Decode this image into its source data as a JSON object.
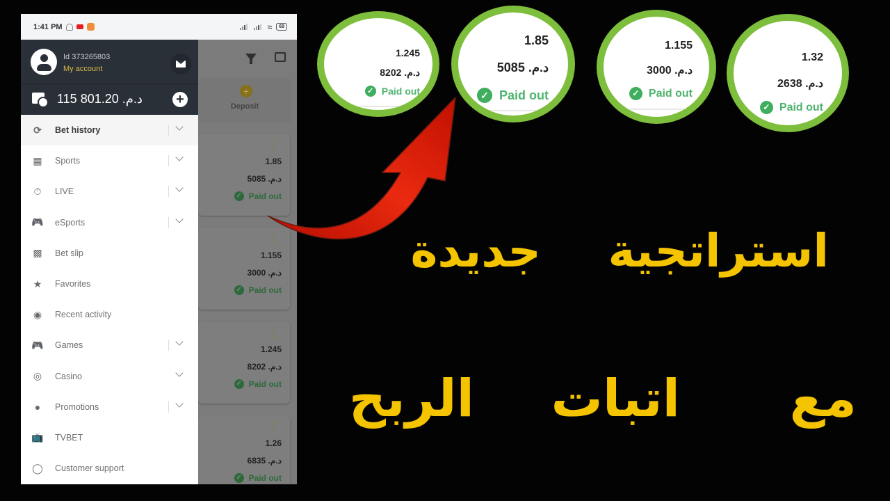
{
  "status_bar": {
    "time": "1:41 PM",
    "battery": "69"
  },
  "background_screen": {
    "deposit_label": "Deposit",
    "bets": [
      {
        "coefficient": "1.85",
        "amount": "5085 .د.م",
        "status": "Paid out"
      },
      {
        "coefficient": "1.155",
        "amount": "3000 .د.م",
        "status": "Paid out"
      },
      {
        "coefficient": "1.245",
        "amount": "8202 .د.م",
        "status": "Paid out"
      },
      {
        "coefficient": "1.26",
        "amount": "6835 .د.م",
        "status": "Paid out"
      }
    ]
  },
  "drawer": {
    "account_id": "Id 373265803",
    "account_link": "My account",
    "balance": "115 801.20 .د.م",
    "menu": [
      {
        "label": "Bet history",
        "icon": "history-icon",
        "expandable": true,
        "active": true
      },
      {
        "label": "Sports",
        "icon": "calendar-icon",
        "expandable": true
      },
      {
        "label": "LIVE",
        "icon": "stopwatch-icon",
        "expandable": true
      },
      {
        "label": "eSports",
        "icon": "gamepad-icon",
        "expandable": true
      },
      {
        "label": "Bet slip",
        "icon": "ticket-icon",
        "expandable": false
      },
      {
        "label": "Favorites",
        "icon": "star-icon",
        "expandable": false
      },
      {
        "label": "Recent activity",
        "icon": "eye-icon",
        "expandable": false
      },
      {
        "label": "Games",
        "icon": "gamepad-icon",
        "expandable": true
      },
      {
        "label": "Casino",
        "icon": "casino-chip-icon",
        "expandable": true
      },
      {
        "label": "Promotions",
        "icon": "balloons-icon",
        "expandable": true
      },
      {
        "label": "TVBET",
        "icon": "tv-icon",
        "expandable": false
      },
      {
        "label": "Customer support",
        "icon": "headset-icon",
        "expandable": false
      }
    ]
  },
  "zoom_circles": [
    {
      "coefficient": "1.245",
      "amount": "8202 .د.م",
      "status": "Paid out"
    },
    {
      "coefficient": "1.85",
      "amount": "5085 .د.م",
      "status": "Paid out"
    },
    {
      "coefficient": "1.155",
      "amount": "3000 .د.م",
      "status": "Paid out"
    },
    {
      "coefficient": "1.32",
      "amount": "2638 .د.م",
      "status": "Paid out"
    }
  ],
  "overlay_text": {
    "line1_word1": "استراتجية",
    "line1_word2": "جديدة",
    "line2_word1": "مع",
    "line2_word2": "اتبات",
    "line2_word3": "الربح"
  },
  "colors": {
    "accent_yellow": "#f5c400",
    "circle_green": "#7dbe3c",
    "paid_green": "#4fb36e",
    "drawer_header": "#2a3038"
  }
}
